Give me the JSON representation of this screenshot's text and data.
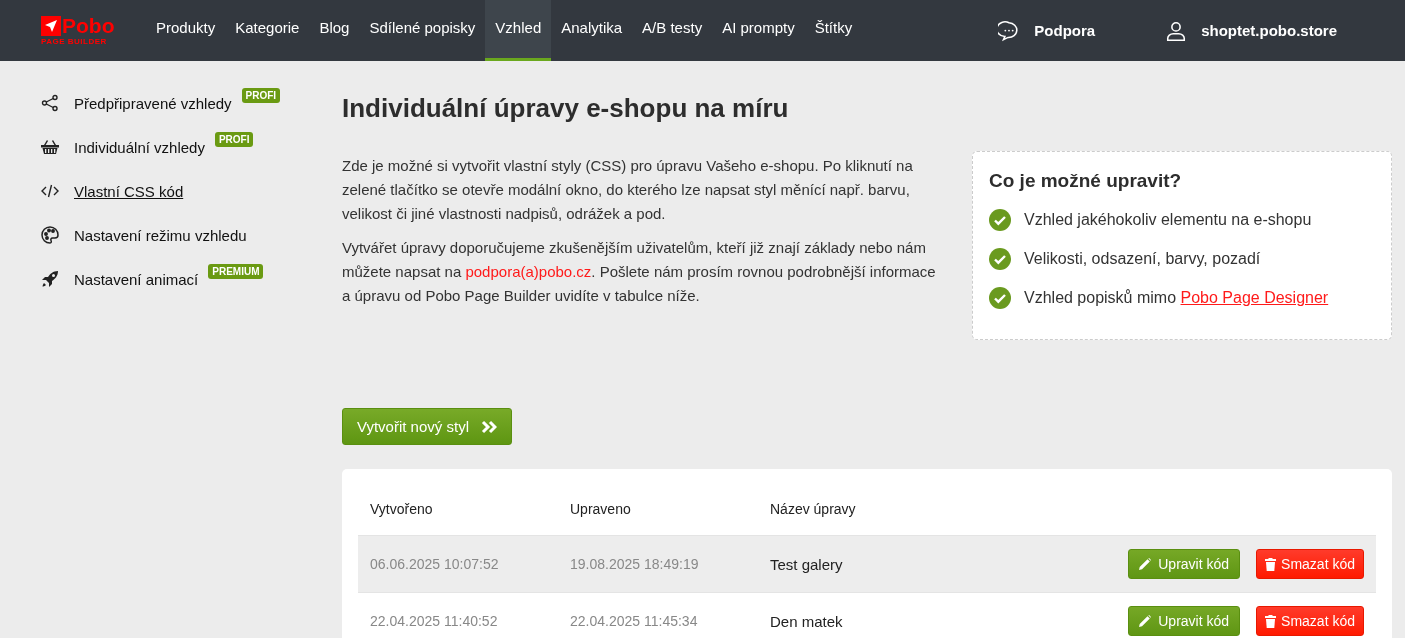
{
  "logo": {
    "name": "Pobo",
    "tagline": "PAGE BUILDER"
  },
  "nav": [
    {
      "label": "Produkty",
      "selected": false
    },
    {
      "label": "Kategorie",
      "selected": false
    },
    {
      "label": "Blog",
      "selected": false
    },
    {
      "label": "Sdílené popisky",
      "selected": false
    },
    {
      "label": "Vzhled",
      "selected": true
    },
    {
      "label": "Analytika",
      "selected": false
    },
    {
      "label": "A/B testy",
      "selected": false
    },
    {
      "label": "AI prompty",
      "selected": false
    },
    {
      "label": "Štítky",
      "selected": false
    }
  ],
  "support": {
    "label": "Podpora"
  },
  "account": {
    "label": "shoptet.pobo.store"
  },
  "sidebar": {
    "items": [
      {
        "kind": "share",
        "label": "Předpřipravené vzhledy",
        "badge": "PROFI",
        "selected": false
      },
      {
        "kind": "basket",
        "label": "Individuální vzhledy",
        "badge": "PROFI",
        "selected": false
      },
      {
        "kind": "code",
        "label": "Vlastní CSS kód",
        "selected": true
      },
      {
        "kind": "palette",
        "label": "Nastavení režimu vzhledu",
        "selected": false
      },
      {
        "kind": "rocket",
        "label": "Nastavení animací",
        "badge": "PREMIUM",
        "selected": false
      }
    ]
  },
  "page": {
    "title": "Individuální úpravy e-shopu na míru",
    "paragraph_1": "Zde je možné si vytvořit vlastní styly (CSS) pro úpravu Vašeho e-shopu. Po kliknutí na zelené tlačítko se otevře modální okno, do kterého lze napsat styl měnící např. barvu, velikost či jiné vlastnosti nadpisů, odrážek a pod.",
    "paragraph_2": {
      "before": "Vytvářet úpravy doporučujeme zkušenějším uživatelům, kteří již znají základy nebo nám můžete napsat na",
      "link": "podpora(a)pobo.cz",
      "after": ". Pošlete nám prosím rovnou podrobnější informace a úpravu od Pobo Page Builder uvidíte v tabulce níže."
    },
    "create_button": "Vytvořit nový styl"
  },
  "info_box": {
    "title": "Co je možné upravit?",
    "items": [
      {
        "text": "Vzhled jakéhokoliv elementu na e-shopu"
      },
      {
        "text": "Velikosti, odsazení, barvy, pozadí"
      },
      {
        "text": "Vzhled popisků mimo",
        "link": "Pobo Page Designer"
      }
    ]
  },
  "table": {
    "columns": [
      "Vytvořeno",
      "Upraveno",
      "Název úpravy"
    ],
    "rows": [
      {
        "created": "06.06.2025 10:07:52",
        "updated": "19.08.2025 18:49:19",
        "name": "Test galery",
        "highlighted": true,
        "edit": "Upravit kód",
        "delete": "Smazat kód"
      },
      {
        "created": "22.04.2025 11:40:52",
        "updated": "22.04.2025 11:45:34",
        "name": "Den matek",
        "highlighted": false,
        "edit": "Upravit kód",
        "delete": "Smazat kód"
      }
    ]
  }
}
